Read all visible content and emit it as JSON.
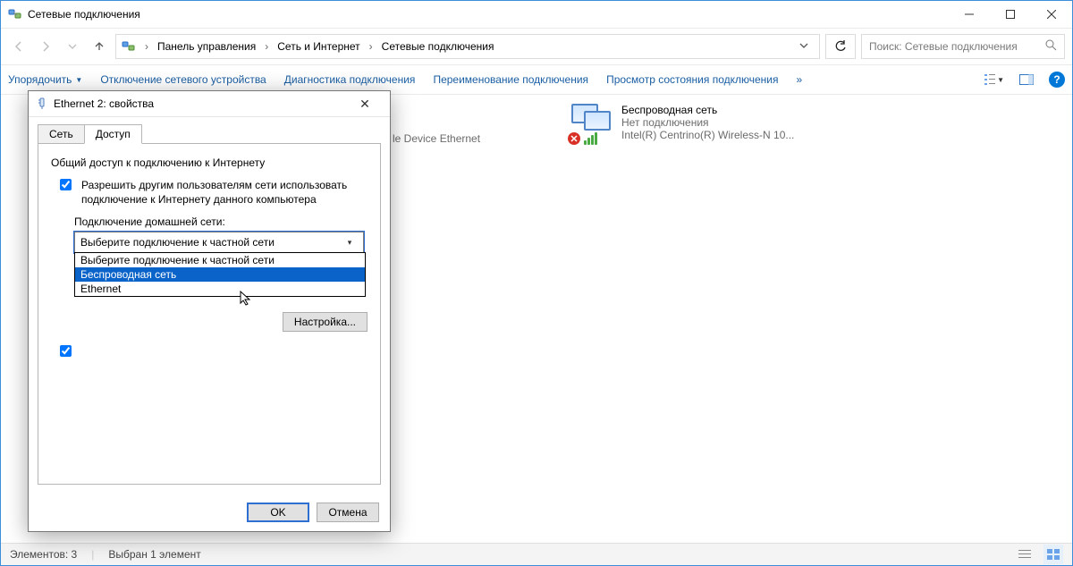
{
  "window": {
    "title": "Сетевые подключения"
  },
  "breadcrumb": {
    "item0": "Панель управления",
    "item1": "Сеть и Интернет",
    "item2": "Сетевые подключения"
  },
  "search": {
    "placeholder": "Поиск: Сетевые подключения"
  },
  "commands": {
    "organize": "Упорядочить",
    "disable": "Отключение сетевого устройства",
    "diagnose": "Диагностика подключения",
    "rename": "Переименование подключения",
    "status": "Просмотр состояния подключения",
    "more": "»"
  },
  "background_item": {
    "partial_text": "le Device Ethernet"
  },
  "wifi_item": {
    "name": "Беспроводная сеть",
    "status": "Нет подключения",
    "device": "Intel(R) Centrino(R) Wireless-N 10..."
  },
  "statusbar": {
    "count": "Элементов: 3",
    "selected": "Выбран 1 элемент"
  },
  "dialog": {
    "title": "Ethernet 2: свойства",
    "tabs": {
      "network": "Сеть",
      "sharing": "Доступ"
    },
    "section": "Общий доступ к подключению к Интернету",
    "allow_label": "Разрешить другим пользователям сети использовать подключение к Интернету данного компьютера",
    "home_conn_label": "Подключение домашней сети:",
    "combo_selected": "Выберите подключение к частной сети",
    "combo_options": {
      "opt0": "Выберите подключение к частной сети",
      "opt1": "Беспроводная сеть",
      "opt2": "Ethernet"
    },
    "configure": "Настройка...",
    "ok": "OK",
    "cancel": "Отмена"
  }
}
